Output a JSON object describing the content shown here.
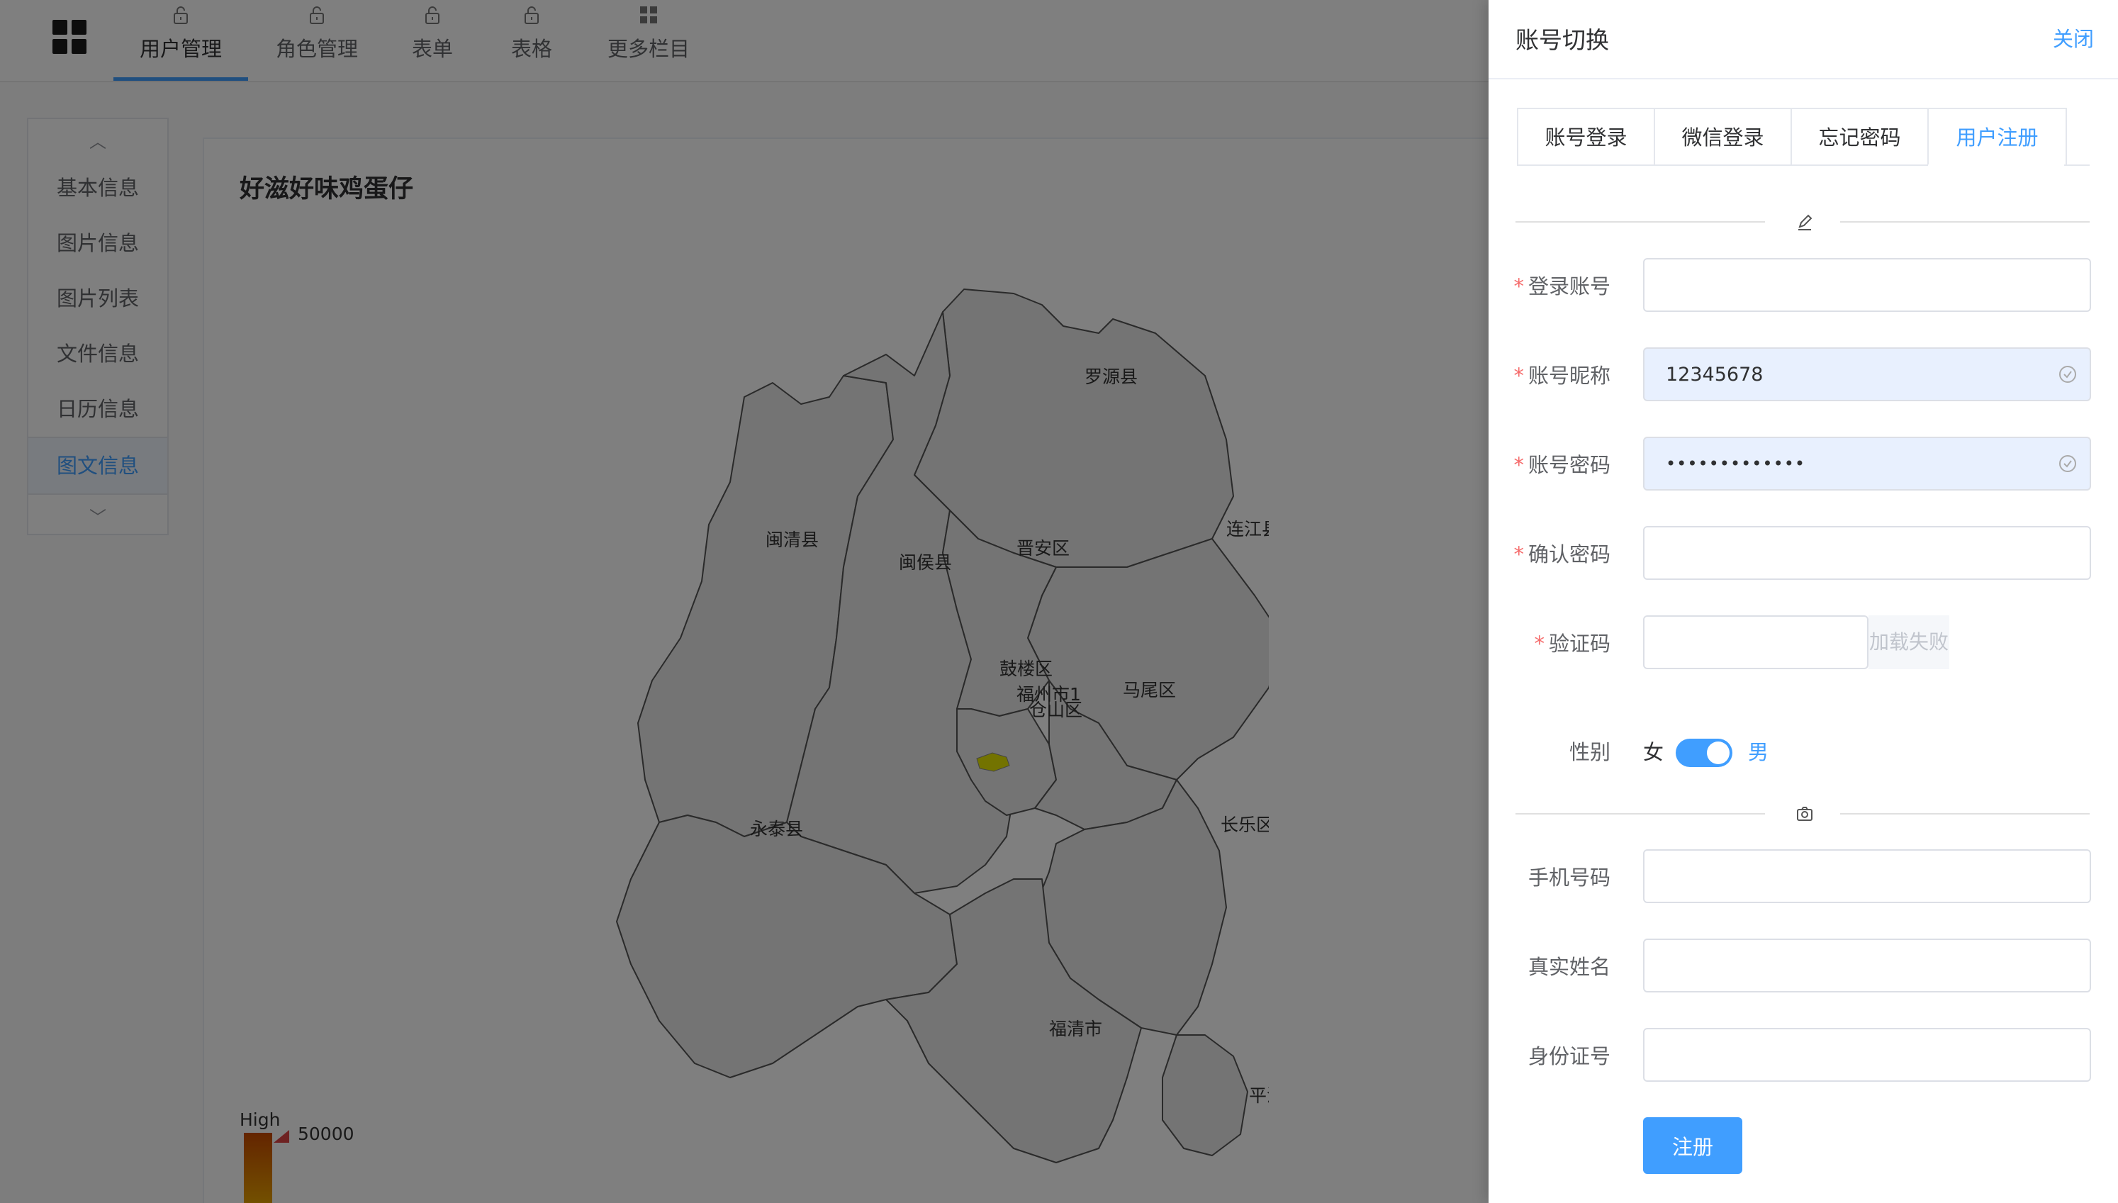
{
  "topnav": {
    "items": [
      {
        "label": "用户管理",
        "icon": "lock-open-icon",
        "active": true
      },
      {
        "label": "角色管理",
        "icon": "lock-open-icon"
      },
      {
        "label": "表单",
        "icon": "lock-open-icon"
      },
      {
        "label": "表格",
        "icon": "lock-open-icon"
      },
      {
        "label": "更多栏目",
        "icon": "grid-icon"
      }
    ]
  },
  "sidebar": {
    "items": [
      {
        "label": "基本信息"
      },
      {
        "label": "图片信息"
      },
      {
        "label": "图片列表"
      },
      {
        "label": "文件信息"
      },
      {
        "label": "日历信息"
      },
      {
        "label": "图文信息",
        "active": true
      }
    ]
  },
  "card": {
    "title": "好滋好味鸡蛋仔",
    "map_labels": [
      "罗源县",
      "连江县",
      "闽清县",
      "闽侯县",
      "晋安区",
      "鼓楼区",
      "福州市1",
      "仓山区",
      "马尾区",
      "永泰县",
      "长乐区",
      "福清市",
      "平潭县"
    ],
    "legend": {
      "high": "High",
      "max": "50000"
    }
  },
  "drawer": {
    "title": "账号切换",
    "close": "关闭",
    "tabs": [
      "账号登录",
      "微信登录",
      "忘记密码",
      "用户注册"
    ],
    "active_tab": 3,
    "fields": {
      "account": {
        "label": "登录账号",
        "value": ""
      },
      "nickname": {
        "label": "账号昵称",
        "value": "12345678"
      },
      "password": {
        "label": "账号密码",
        "value": "•••••••••••••"
      },
      "confirm": {
        "label": "确认密码",
        "value": ""
      },
      "captcha": {
        "label": "验证码",
        "value": "",
        "image_text": "加载失败"
      },
      "phone": {
        "label": "手机号码",
        "value": ""
      },
      "realname": {
        "label": "真实姓名",
        "value": ""
      },
      "idcard": {
        "label": "身份证号",
        "value": ""
      }
    },
    "gender": {
      "label": "性别",
      "female": "女",
      "male": "男",
      "selected": "男"
    },
    "submit": "注册",
    "required_mark": "*"
  },
  "colors": {
    "primary": "#409eff",
    "required": "#f56c6c",
    "autofill": "#e8f0fe"
  }
}
